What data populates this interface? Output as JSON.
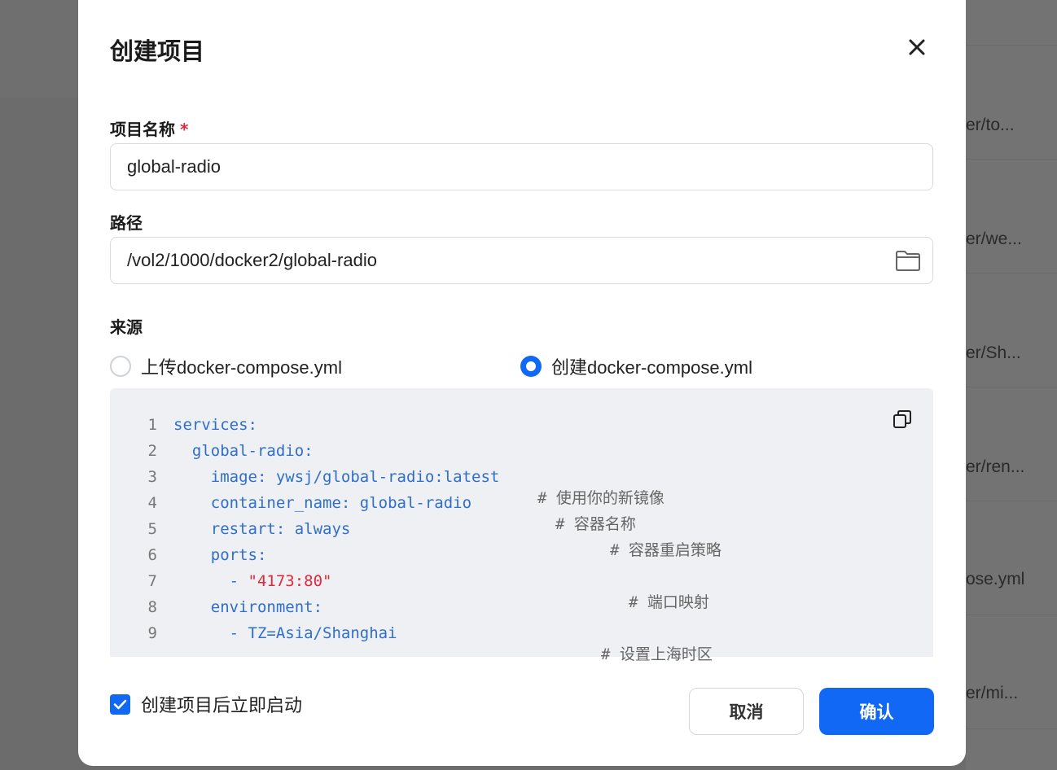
{
  "background": {
    "rows": [
      "er/to...",
      "er/we...",
      "er/Sh...",
      "er/ren...",
      "ose.yml",
      "er/mi..."
    ]
  },
  "dialog": {
    "title": "创建项目",
    "name_label": "项目名称",
    "required_mark": "*",
    "name_value": "global-radio",
    "path_label": "路径",
    "path_value": "/vol2/1000/docker2/global-radio",
    "source_label": "来源",
    "source_options": [
      {
        "label": "上传docker-compose.yml",
        "selected": false
      },
      {
        "label": "创建docker-compose.yml",
        "selected": true
      }
    ],
    "editor_lines": [
      {
        "n": "1",
        "code": "services:",
        "comment": ""
      },
      {
        "n": "2",
        "code": "  global-radio:",
        "comment": ""
      },
      {
        "n": "3",
        "code": "    image: ywsj/global-radio:latest",
        "comment": "# 使用你的新镜像"
      },
      {
        "n": "4",
        "code": "    container_name: global-radio",
        "comment": "# 容器名称"
      },
      {
        "n": "5",
        "code": "    restart: always",
        "comment": "# 容器重启策略"
      },
      {
        "n": "6",
        "code": "    ports:",
        "comment": ""
      },
      {
        "n": "7",
        "code": "      - ",
        "string": "\"4173:80\"",
        "comment": "# 端口映射"
      },
      {
        "n": "8",
        "code": "    environment:",
        "comment": ""
      },
      {
        "n": "9",
        "code": "      - TZ=Asia/Shanghai",
        "comment": "# 设置上海时区"
      }
    ],
    "autostart_label": "创建项目后立即启动",
    "autostart_checked": true,
    "cancel_label": "取消",
    "confirm_label": "确认"
  },
  "colors": {
    "accent": "#1168f5",
    "required": "#e0283c",
    "code": "#2f6fcb"
  }
}
